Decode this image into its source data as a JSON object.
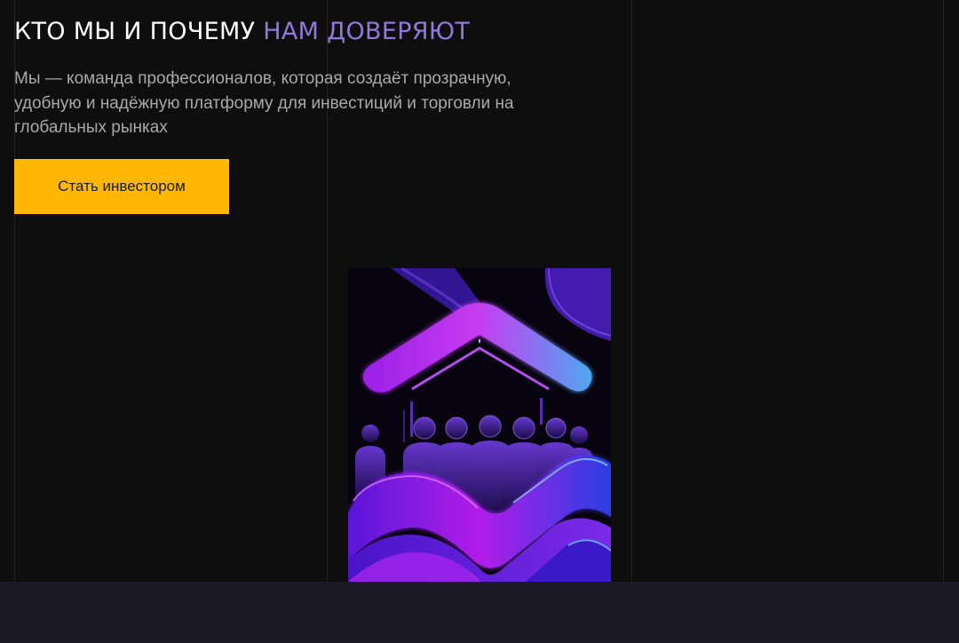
{
  "hero": {
    "title_main": "КТО МЫ И ПОЧЕМУ",
    "title_accent": "НАМ ДОВЕРЯЮТ",
    "description": "Мы — команда профессионалов, которая создаёт прозрачную, удобную и надёжную платформу для инвестиций и торговли на глобальных рынках",
    "cta_label": "Стать инвестором"
  },
  "illustration": {
    "icon": "team-trust-illustration"
  },
  "colors": {
    "background": "#0e0e0e",
    "accent_purple": "#8f7ad9",
    "cta_yellow": "#ffb703",
    "footer": "#1b1923"
  }
}
